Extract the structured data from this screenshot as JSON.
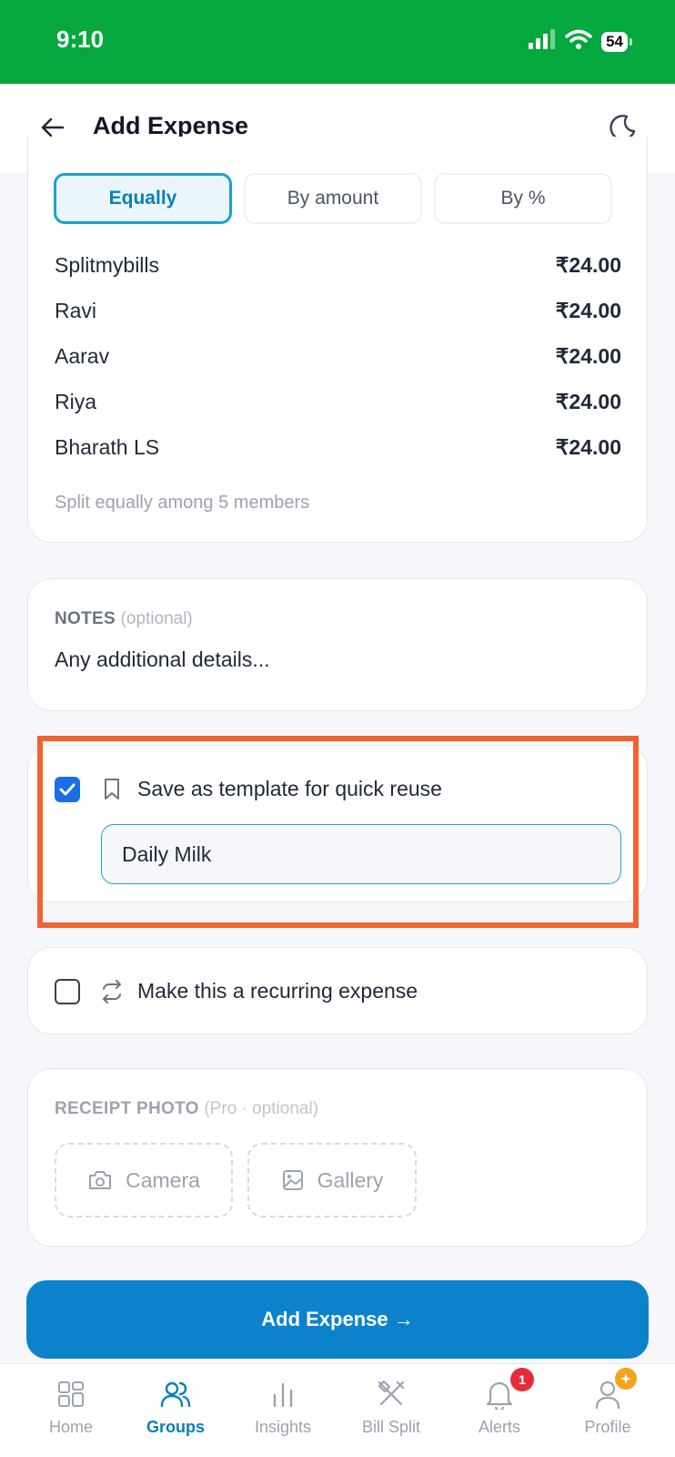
{
  "status_bar": {
    "time": "9:10",
    "battery": "54"
  },
  "header": {
    "title": "Add Expense"
  },
  "split": {
    "tabs": [
      {
        "label": "Equally",
        "active": true
      },
      {
        "label": "By amount",
        "active": false
      },
      {
        "label": "By %",
        "active": false
      }
    ],
    "members": [
      {
        "name": "Splitmybills",
        "amount": "₹24.00"
      },
      {
        "name": "Ravi",
        "amount": "₹24.00"
      },
      {
        "name": "Aarav",
        "amount": "₹24.00"
      },
      {
        "name": "Riya",
        "amount": "₹24.00"
      },
      {
        "name": "Bharath LS",
        "amount": "₹24.00"
      }
    ],
    "note": "Split equally among 5 members"
  },
  "notes": {
    "label": "NOTES",
    "optional": "(optional)",
    "placeholder": "Any additional details..."
  },
  "template": {
    "checked": true,
    "label": "Save as template for quick reuse",
    "name_value": "Daily Milk"
  },
  "recurring": {
    "checked": false,
    "label": "Make this a recurring expense"
  },
  "receipt": {
    "label": "RECEIPT PHOTO",
    "qualifier": "(Pro · optional)",
    "camera_label": "Camera",
    "gallery_label": "Gallery"
  },
  "submit": {
    "label": "Add Expense →"
  },
  "bottom_nav": {
    "items": [
      {
        "label": "Home",
        "icon": "home-grid-icon"
      },
      {
        "label": "Groups",
        "icon": "users-icon",
        "active": true
      },
      {
        "label": "Insights",
        "icon": "bar-chart-icon"
      },
      {
        "label": "Bill Split",
        "icon": "utensils-icon"
      },
      {
        "label": "Alerts",
        "icon": "bell-icon",
        "badge": "1"
      },
      {
        "label": "Profile",
        "icon": "user-icon"
      }
    ]
  },
  "colors": {
    "status_bar": "#05a83e",
    "accent": "#0c82cd",
    "active_tab_border": "#1aa0d8",
    "checkbox": "#1b6ee6",
    "highlight": "#f26332",
    "alert_badge": "#e52d3a",
    "pro_badge": "#f5a21b"
  }
}
